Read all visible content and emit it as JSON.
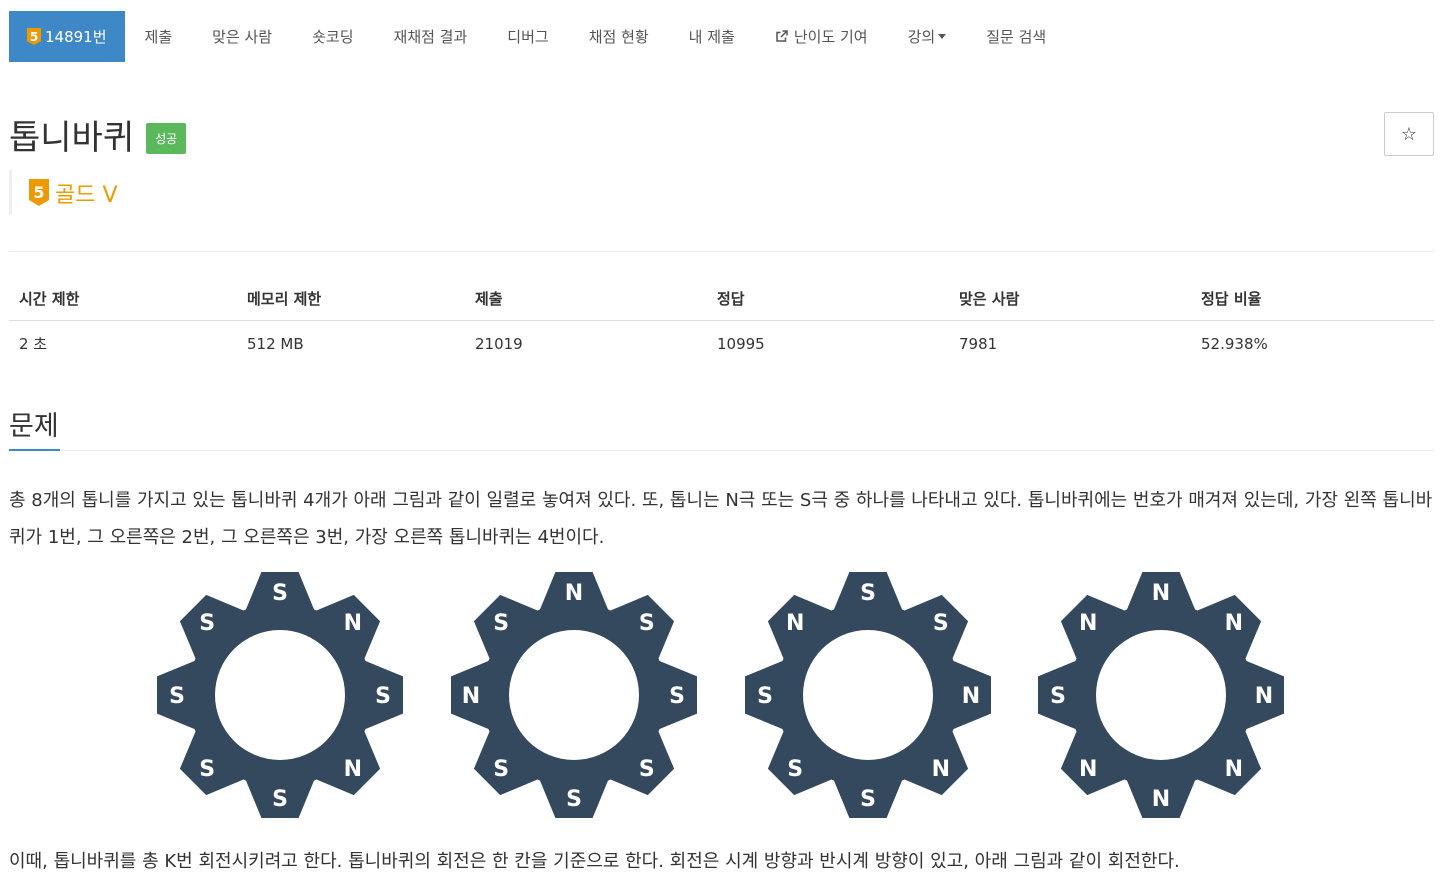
{
  "nav": {
    "problem_id": "14891번",
    "tier_num": "5",
    "items": [
      "제출",
      "맞은 사람",
      "숏코딩",
      "재채점 결과",
      "디버그",
      "채점 현황",
      "내 제출"
    ],
    "difficulty": "난이도 기여",
    "lecture": "강의",
    "question_search": "질문 검색"
  },
  "problem": {
    "title": "톱니바퀴",
    "status_label": "성공",
    "star": "☆",
    "tier_num": "5",
    "tier_text": "골드 V"
  },
  "info_table": {
    "headers": [
      "시간 제한",
      "메모리 제한",
      "제출",
      "정답",
      "맞은 사람",
      "정답 비율"
    ],
    "values": [
      "2 초",
      "512 MB",
      "21019",
      "10995",
      "7981",
      "52.938%"
    ]
  },
  "section": {
    "title": "문제",
    "para1": "총 8개의 톱니를 가지고 있는 톱니바퀴 4개가 아래 그림과 같이 일렬로 놓여져 있다. 또, 톱니는 N극 또는 S극 중 하나를 나타내고 있다. 톱니바퀴에는 번호가 매겨져 있는데, 가장 왼쪽 톱니바퀴가 1번, 그 오른쪽은 2번, 그 오른쪽은 3번, 가장 오른쪽 톱니바퀴는 4번이다.",
    "para2": "이때, 톱니바퀴를 총 K번 회전시키려고 한다. 톱니바퀴의 회전은 한 칸을 기준으로 한다. 회전은 시계 방향과 반시계 방향이 있고, 아래 그림과 같이 회전한다."
  },
  "gears": [
    [
      "S",
      "N",
      "S",
      "N",
      "S",
      "S",
      "S",
      "S"
    ],
    [
      "N",
      "S",
      "S",
      "S",
      "S",
      "S",
      "N",
      "S"
    ],
    [
      "S",
      "S",
      "N",
      "N",
      "S",
      "S",
      "S",
      "N"
    ],
    [
      "N",
      "N",
      "N",
      "N",
      "N",
      "N",
      "S",
      "N"
    ]
  ],
  "colors": {
    "gear": "#34495e",
    "accent": "#3e88c8",
    "tier": "#ec9a00",
    "success": "#5cb85c"
  }
}
